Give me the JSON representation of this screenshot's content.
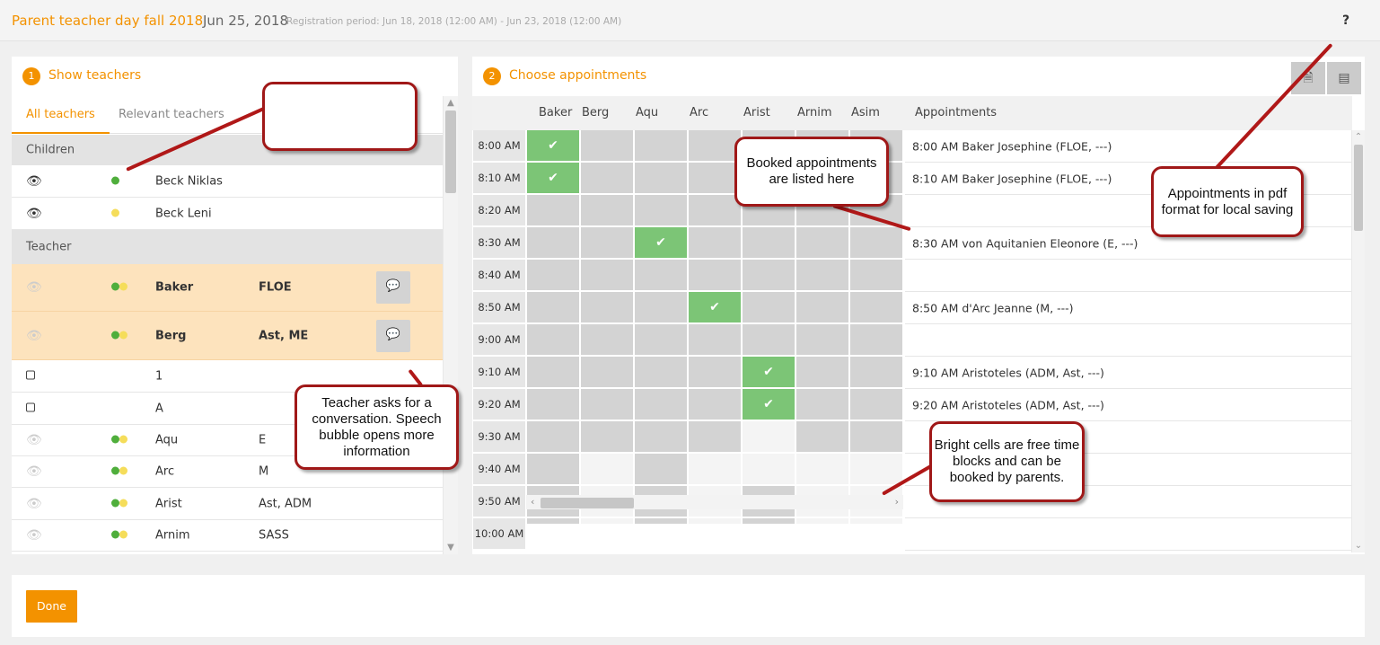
{
  "header": {
    "title": "Parent teacher day fall 2018",
    "date": "Jun 25, 2018",
    "registration": "Registration period: Jun 18, 2018 (12:00 AM) - Jun 23, 2018 (12:00 AM)",
    "help": "?"
  },
  "left_panel": {
    "step": "1",
    "title": "Show teachers",
    "tabs": [
      "All teachers",
      "Relevant teachers"
    ],
    "children_section": "Children",
    "children": [
      {
        "name": "Beck Niklas",
        "status": "green"
      },
      {
        "name": "Beck Leni",
        "status": "yellow"
      }
    ],
    "teacher_section": "Teacher",
    "teachers": [
      {
        "name": "Baker",
        "subjects": "FLOE",
        "bold": true,
        "requested": true
      },
      {
        "name": "Berg",
        "subjects": "Ast, ME",
        "bold": true,
        "requested": true
      },
      {
        "name": "1",
        "subjects": "",
        "checkbox": true
      },
      {
        "name": "A",
        "subjects": "",
        "checkbox": true
      },
      {
        "name": "Aqu",
        "subjects": "E"
      },
      {
        "name": "Arc",
        "subjects": "M"
      },
      {
        "name": "Arist",
        "subjects": "Ast, ADM"
      },
      {
        "name": "Arnim",
        "subjects": "SASS"
      }
    ]
  },
  "right_panel": {
    "step": "2",
    "title": "Choose appointments",
    "columns": [
      "Baker",
      "Berg",
      "Aqu",
      "Arc",
      "Arist",
      "Arnim",
      "Asim"
    ],
    "appointments_header": "Appointments",
    "times": [
      "8:00 AM",
      "8:10 AM",
      "8:20 AM",
      "8:30 AM",
      "8:40 AM",
      "8:50 AM",
      "9:00 AM",
      "9:10 AM",
      "9:20 AM",
      "9:30 AM",
      "9:40 AM",
      "9:50 AM",
      "10:00 AM"
    ],
    "appointments": [
      "8:00 AM Baker Josephine (FLOE, ---)",
      "8:10 AM Baker Josephine (FLOE, ---)",
      "",
      "8:30 AM von Aquitanien Eleonore (E, ---)",
      "",
      "8:50 AM d'Arc Jeanne (M, ---)",
      "",
      "9:10 AM Aristoteles (ADM, Ast, ---)",
      "9:20 AM Aristoteles (ADM, Ast, ---)",
      "",
      "",
      "",
      ""
    ]
  },
  "footer": {
    "done": "Done"
  },
  "callouts": {
    "blank": "",
    "booked": "Booked appointments are listed here",
    "pdf": "Appointments in pdf format for local saving",
    "conversation": "Teacher asks for a conversation. Speech bubble opens more information",
    "bright": "Bright cells are free time blocks and can be booked by parents."
  },
  "colors": {
    "accent": "#f39200",
    "booked": "#7cc576",
    "highlight": "#fde3bd",
    "callout_border": "#a01818"
  }
}
